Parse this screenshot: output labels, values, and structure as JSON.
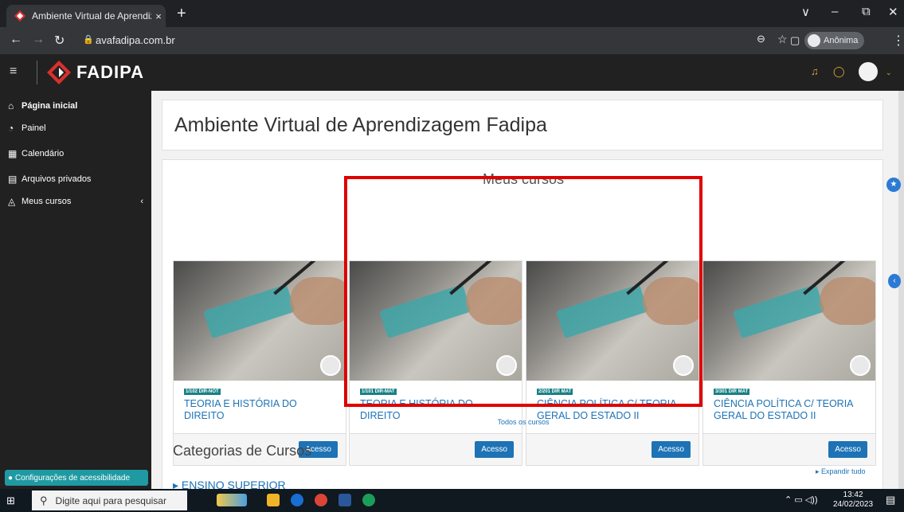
{
  "browser": {
    "tab_title": "Ambiente Virtual de Aprendizage",
    "tab_close": "×",
    "new_tab": "+",
    "url": "avafadipa.com.br",
    "profile_label": "Anônima",
    "win_min": "–",
    "win_max": "⧉",
    "win_close": "✕",
    "win_dropdown": "∨"
  },
  "header": {
    "brand": "FADIPA"
  },
  "sidebar": {
    "items": [
      {
        "label": "Página inicial",
        "icon": "home-icon"
      },
      {
        "label": "Painel",
        "icon": "dashboard-icon"
      },
      {
        "label": "Calendário",
        "icon": "calendar-icon"
      },
      {
        "label": "Arquivos privados",
        "icon": "files-icon"
      },
      {
        "label": "Meus cursos",
        "icon": "courses-icon"
      }
    ],
    "accessibility": "Configurações de acessibilidade"
  },
  "main": {
    "title": "Ambiente Virtual de Aprendizagem Fadipa",
    "my_courses_heading": "Meus cursos",
    "courses": [
      {
        "badge": "1/102 DIR-NOT",
        "name": "TEORIA E HISTÓRIA DO DIREITO",
        "button": "Acesso"
      },
      {
        "badge": "1/101 DIR-MAT",
        "name": "TEORIA E HISTÓRIA DO DIREITO",
        "button": "Acesso"
      },
      {
        "badge": "2/201 DIR MAT",
        "name": "CIÊNCIA POLÍTICA C/ TEORIA GERAL DO ESTADO II",
        "button": "Acesso"
      },
      {
        "badge": "3/301 DIR MAT",
        "name": "CIÊNCIA POLÍTICA C/ TEORIA GERAL DO ESTADO II",
        "button": "Acesso"
      }
    ],
    "all_courses": "Todos os cursos",
    "categories_heading": "Categorias de Cursos",
    "expand_all": "▸ Expandir tudo",
    "category_first": "▸ ENSINO SUPERIOR"
  },
  "taskbar": {
    "search_placeholder": "Digite aqui para pesquisar",
    "time": "13:42",
    "date": "24/02/2023"
  },
  "colors": {
    "accent_blue": "#1d73b5",
    "badge_teal": "#188087",
    "highlight_red": "#e00000",
    "header_dark": "#212121"
  }
}
